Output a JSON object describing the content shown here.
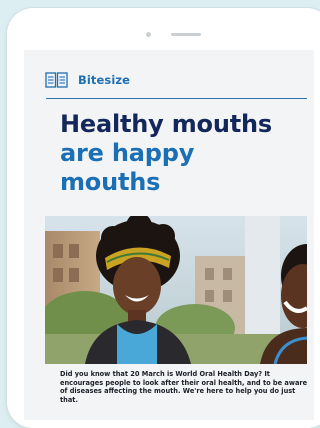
{
  "brand": {
    "icon": "open-book-icon",
    "label": "Bitesize",
    "accent_color": "#1f6fb2"
  },
  "headline": {
    "line1": "Healthy mouths",
    "line2a": "are happy",
    "line2b": "mouths",
    "color_primary": "#13275a",
    "color_accent": "#1b6fb5"
  },
  "photo": {
    "description_icon": "photo-two-women-laughing"
  },
  "intro_text": "Did you know that 20 March is World Oral Health Day? It encourages people to look after their oral health, and to be aware of diseases affecting the mouth. We're here to help you do just that."
}
